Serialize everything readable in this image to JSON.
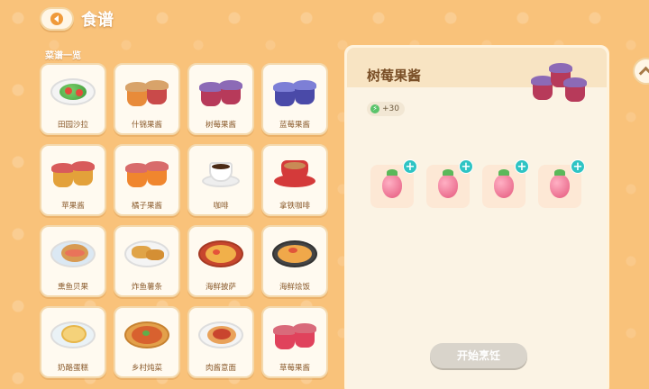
{
  "header": {
    "title": "食谱"
  },
  "section_label": "菜谱一览",
  "recipes": [
    {
      "label": "田园沙拉",
      "icon": "salad-icon"
    },
    {
      "label": "什锦果酱",
      "icon": "mixed-jam-icon"
    },
    {
      "label": "树莓果酱",
      "icon": "raspberry-jam-icon"
    },
    {
      "label": "蓝莓果酱",
      "icon": "blueberry-jam-icon"
    },
    {
      "label": "苹果酱",
      "icon": "apple-jam-icon"
    },
    {
      "label": "橘子果酱",
      "icon": "orange-jam-icon"
    },
    {
      "label": "咖啡",
      "icon": "coffee-icon"
    },
    {
      "label": "拿铁咖啡",
      "icon": "latte-icon"
    },
    {
      "label": "熏鱼贝果",
      "icon": "bagel-icon"
    },
    {
      "label": "炸鱼薯条",
      "icon": "fish-chips-icon"
    },
    {
      "label": "海鲜披萨",
      "icon": "pizza-icon"
    },
    {
      "label": "海鲜烩饭",
      "icon": "paella-icon"
    },
    {
      "label": "奶酪蛋糕",
      "icon": "cheesecake-icon"
    },
    {
      "label": "乡村炖菜",
      "icon": "stew-icon"
    },
    {
      "label": "肉酱意面",
      "icon": "pasta-icon"
    },
    {
      "label": "草莓果酱",
      "icon": "strawberry-jam-icon"
    }
  ],
  "panel": {
    "title": "树莓果酱",
    "energy": "+30",
    "ingredients": [
      "raspberry-icon",
      "raspberry-icon",
      "raspberry-icon",
      "raspberry-icon"
    ],
    "cook_button": "开始烹饪"
  },
  "colors": {
    "accent": "#f09a3a",
    "plus": "#2ec4c4",
    "bg": "#f9c27a"
  }
}
